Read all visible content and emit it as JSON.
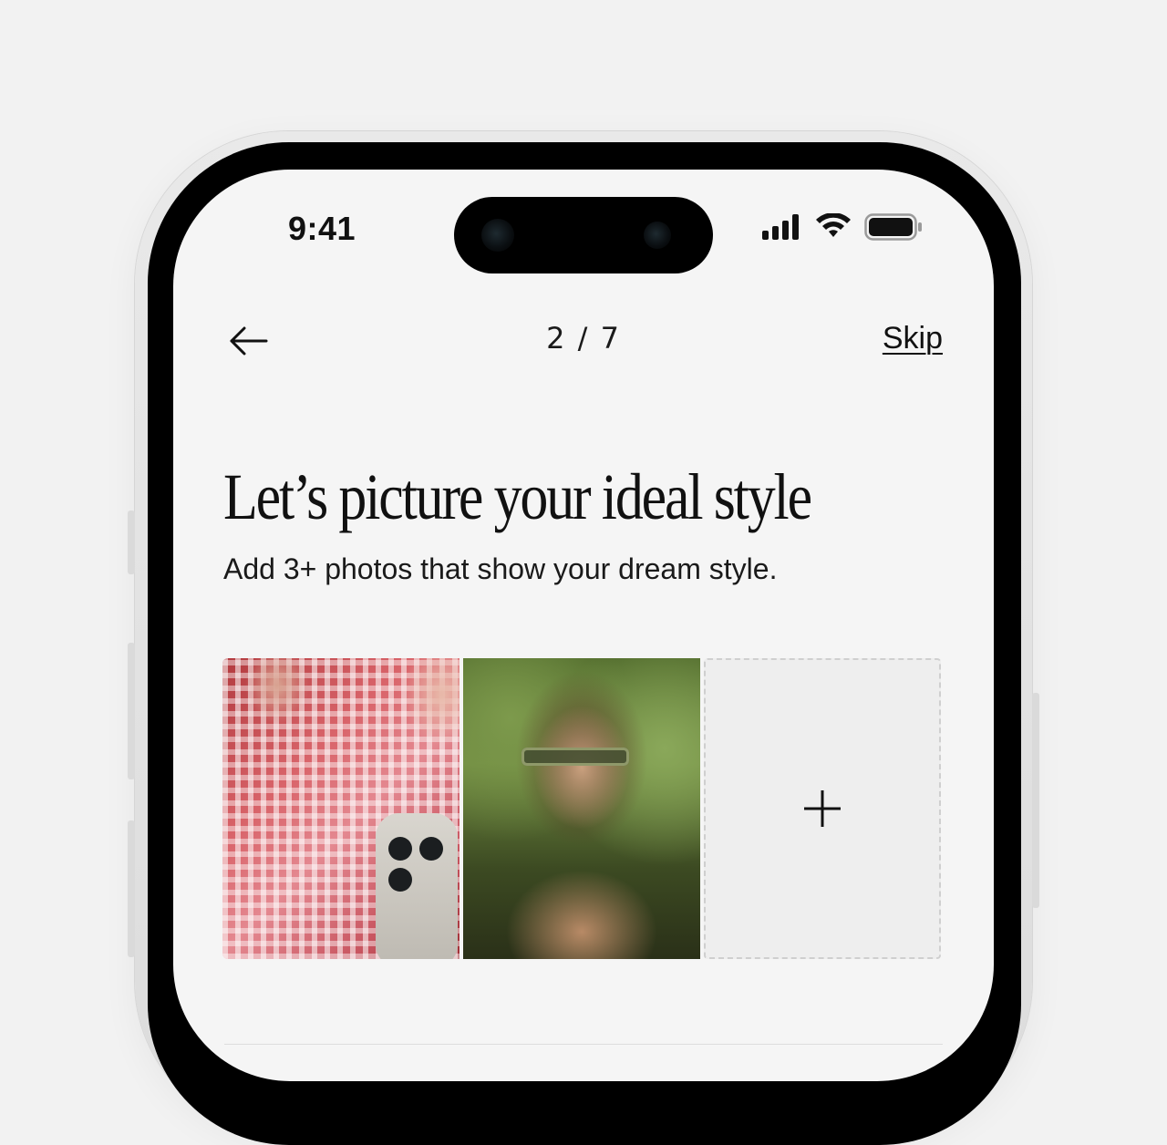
{
  "status_bar": {
    "time": "9:41",
    "icons": [
      "cellular-signal-icon",
      "wifi-icon",
      "battery-icon"
    ]
  },
  "nav": {
    "back_icon": "arrow-left-icon",
    "progress": "2 / 7",
    "skip_label": "Skip"
  },
  "header": {
    "title": "Let’s picture your ideal style",
    "subtitle": "Add 3+ photos that show your dream style."
  },
  "photos": {
    "items": [
      {
        "kind": "photo"
      },
      {
        "kind": "photo"
      },
      {
        "kind": "add",
        "icon": "plus-icon"
      }
    ]
  },
  "colors": {
    "background": "#f2f2f2",
    "screen": "#f5f5f5",
    "text": "#111111",
    "add_tile": "#eeeeee"
  }
}
